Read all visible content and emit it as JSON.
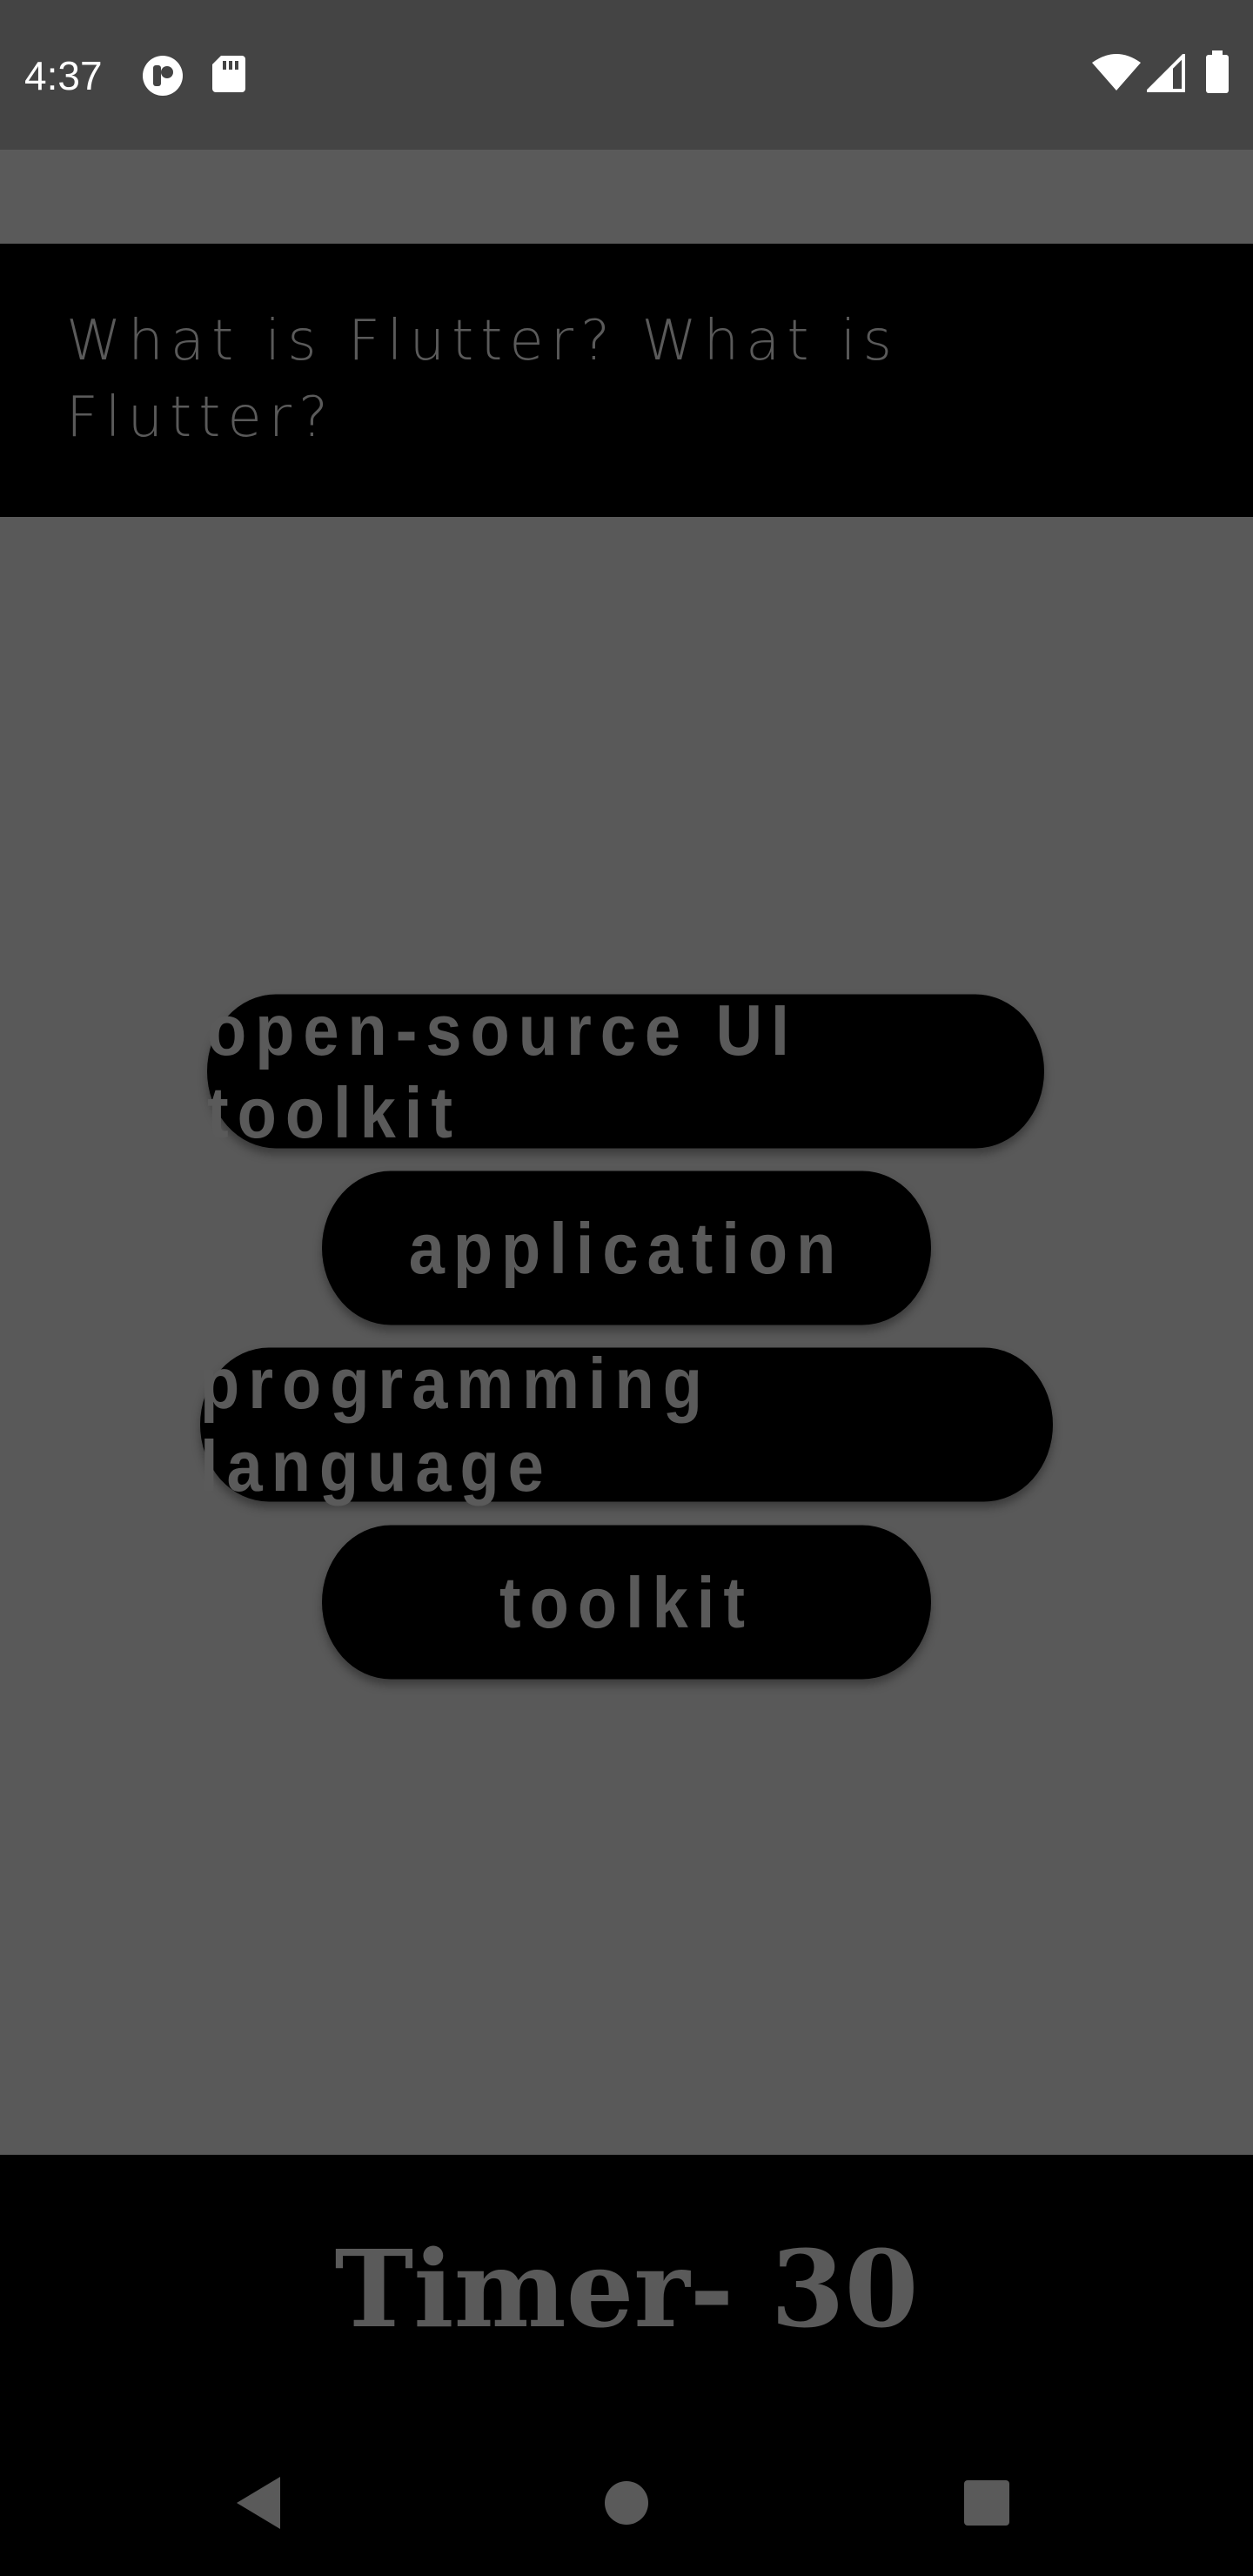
{
  "status_bar": {
    "time": "4:37",
    "left_icons": [
      "podcast-app-icon",
      "sd-card-icon"
    ],
    "right_icons": [
      "wifi-icon",
      "cellular-signal-icon",
      "battery-icon"
    ]
  },
  "question": {
    "text": "What is Flutter? What is Flutter?"
  },
  "answers": [
    {
      "label": "open-source UI toolkit"
    },
    {
      "label": "application"
    },
    {
      "label": "programming language"
    },
    {
      "label": "toolkit"
    }
  ],
  "timer": {
    "text": "Timer- 30"
  },
  "nav_bar": {
    "icons": [
      "back-icon",
      "home-icon",
      "recents-icon"
    ]
  },
  "colors": {
    "background": "#595959",
    "status_bar": "#444444",
    "panel": "#000000",
    "muted_text": "#5a5a5a"
  }
}
